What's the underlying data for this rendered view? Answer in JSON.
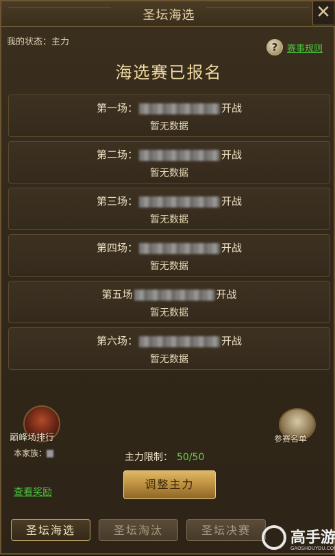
{
  "window": {
    "title": "圣坛海选"
  },
  "status": {
    "label": "我的状态：",
    "value": "主力"
  },
  "rules": {
    "label": "赛事规则"
  },
  "headline": "海选赛已报名",
  "matches": [
    {
      "label": "第一场：",
      "suffix": "开战",
      "data": "暂无数据"
    },
    {
      "label": "第二场：",
      "suffix": "开战",
      "data": "暂无数据"
    },
    {
      "label": "第三场：",
      "suffix": "开战",
      "data": "暂无数据"
    },
    {
      "label": "第四场：",
      "suffix": "开战",
      "data": "暂无数据"
    },
    {
      "label": "第五场",
      "suffix": "开战",
      "data": "暂无数据"
    },
    {
      "label": "第六场：",
      "suffix": "开战",
      "data": "暂无数据"
    }
  ],
  "ranking": {
    "label": "巅峰场排行"
  },
  "family": {
    "label": "本家族："
  },
  "participants": {
    "label": "参赛名单"
  },
  "limit": {
    "label": "主力限制：",
    "value": "50/50"
  },
  "reward": {
    "label": "查看奖励"
  },
  "adjust": {
    "label": "调整主力"
  },
  "tabs": [
    {
      "label": "圣坛海选"
    },
    {
      "label": "圣坛淘汰"
    },
    {
      "label": "圣坛决赛"
    }
  ],
  "watermark": {
    "brand": "高手游",
    "site": "GAOSHOUYOU.COM"
  }
}
